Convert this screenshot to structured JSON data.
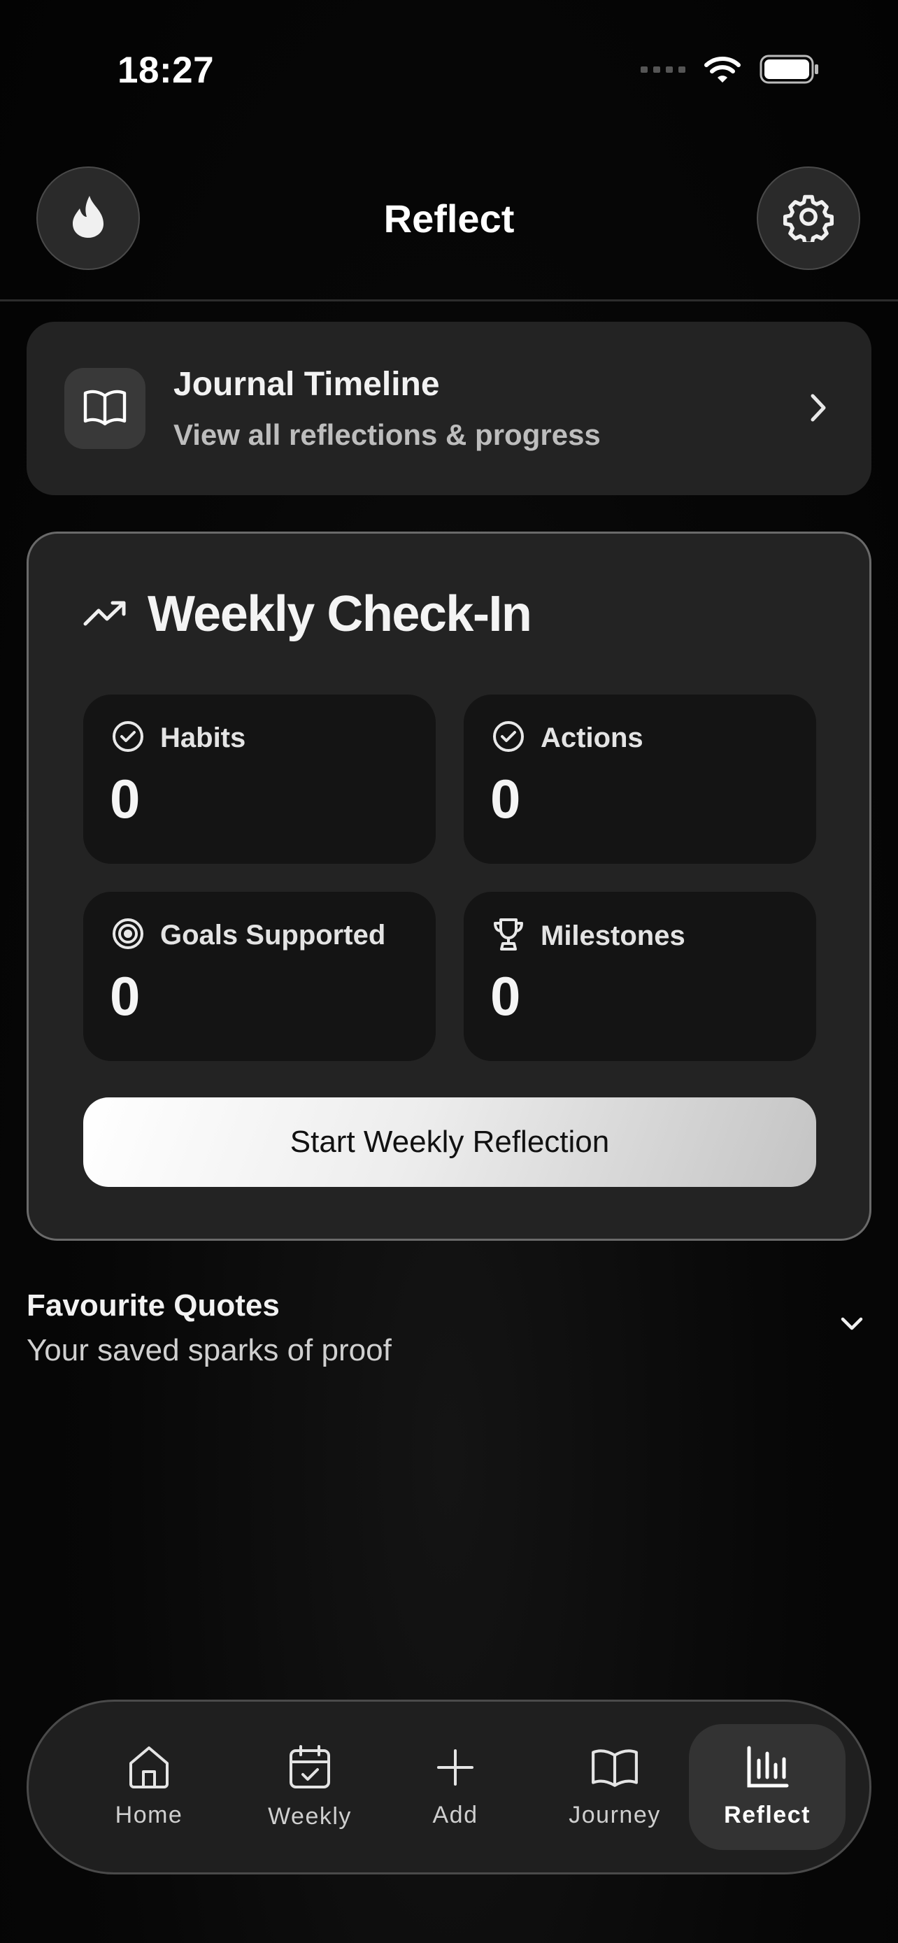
{
  "status_bar": {
    "time": "18:27"
  },
  "header": {
    "title": "Reflect",
    "left_icon": "flame-icon",
    "right_icon": "gear-icon"
  },
  "timeline_card": {
    "title": "Journal Timeline",
    "subtitle": "View all reflections & progress",
    "icon": "book-open-icon"
  },
  "weekly_checkin": {
    "title": "Weekly Check-In",
    "icon": "trending-up-icon",
    "stats": [
      {
        "label": "Habits",
        "value": "0",
        "icon": "check-circle-icon"
      },
      {
        "label": "Actions",
        "value": "0",
        "icon": "check-circle-icon"
      },
      {
        "label": "Goals Supported",
        "value": "0",
        "icon": "target-icon"
      },
      {
        "label": "Milestones",
        "value": "0",
        "icon": "trophy-icon"
      }
    ],
    "button_label": "Start Weekly Reflection"
  },
  "favourite_quotes": {
    "title": "Favourite Quotes",
    "subtitle": "Your saved sparks of proof",
    "expanded": false
  },
  "bottom_nav": {
    "items": [
      {
        "label": "Home",
        "icon": "home-icon",
        "active": false
      },
      {
        "label": "Weekly",
        "icon": "calendar-check-icon",
        "active": false
      },
      {
        "label": "Add",
        "icon": "plus-icon",
        "active": false
      },
      {
        "label": "Journey",
        "icon": "book-open-icon",
        "active": false
      },
      {
        "label": "Reflect",
        "icon": "bar-chart-icon",
        "active": true
      }
    ]
  },
  "colors": {
    "background": "#050505",
    "card": "#232323",
    "tile": "#141414",
    "accent_text": "#ffffff",
    "muted_text": "#bdbdbd"
  }
}
